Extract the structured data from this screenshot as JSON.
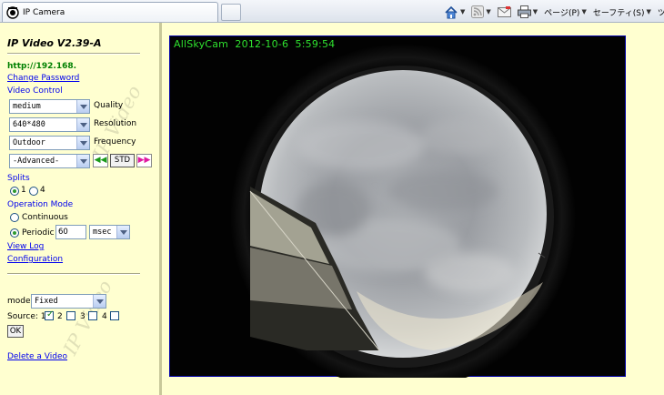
{
  "browser": {
    "tab_title": "IP Camera",
    "page_menu": "ページ(P)",
    "safety_menu": "セーフティ(S)",
    "tools_menu": "ツ"
  },
  "panel": {
    "title": "IP Video V2.39-A",
    "ip_address": "http://192.168.",
    "change_password": "Change Password",
    "video_control": "Video Control",
    "quality": {
      "value": "medium",
      "label": "Quality"
    },
    "resolution": {
      "value": "640*480",
      "label": "Resolution"
    },
    "frequency": {
      "value": "Outdoor",
      "label": "Frequency"
    },
    "advanced": {
      "value": "-Advanced-"
    },
    "rewind_label": "◀◀",
    "std_label": "STD",
    "forward_label": "▶▶",
    "splits_heading": "Splits",
    "split_1": "1",
    "split_4": "4",
    "operation_mode": "Operation Mode",
    "continuous": "Continuous",
    "periodic": "Periodic",
    "period_value": "60",
    "period_unit": "msec",
    "view_log": "View Log",
    "configuration": "Configuration",
    "mode_label": "mode:",
    "mode_value": "Fixed",
    "source_label": "Source: 1",
    "source_2": "2",
    "source_3": "3",
    "source_4": "4",
    "ok_label": "OK",
    "delete_video": "Delete a Video",
    "watermark": "IP Video"
  },
  "camera": {
    "overlay": "AllSkyCam  2012-10-6  5:59:54"
  },
  "colors": {
    "panel_bg": "#ffffd0",
    "link": "#0000ee",
    "overlay_text": "#2fe02f"
  }
}
